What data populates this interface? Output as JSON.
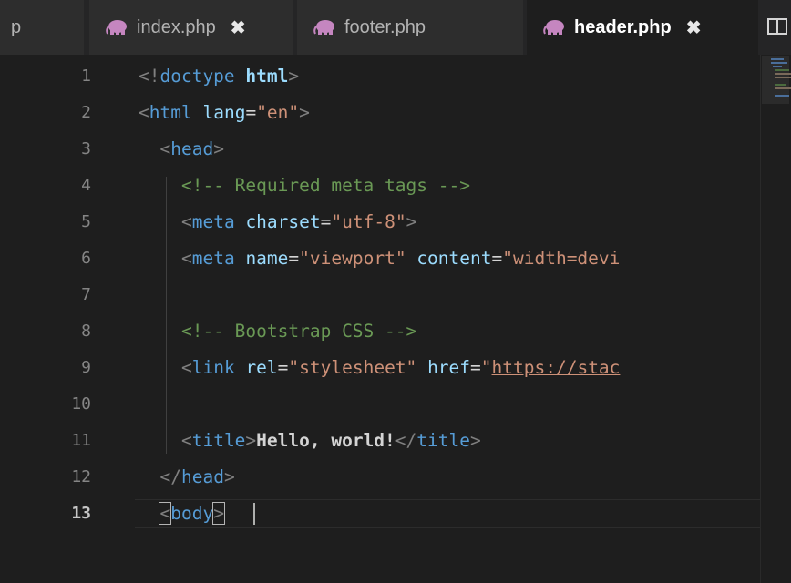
{
  "tabs": {
    "partial_label": "p",
    "items": [
      {
        "label": "index.php",
        "close": "✖"
      },
      {
        "label": "footer.php",
        "close": ""
      },
      {
        "label": "header.php",
        "close": "✖"
      }
    ]
  },
  "editor": {
    "active_file": "header.php",
    "current_line": "13",
    "line_numbers": [
      "1",
      "2",
      "3",
      "4",
      "5",
      "6",
      "7",
      "8",
      "9",
      "10",
      "11",
      "12",
      "13"
    ],
    "lines": [
      [
        [
          "punc",
          "<!"
        ],
        [
          "tag",
          "doctype"
        ],
        [
          "text",
          " "
        ],
        [
          "attrb",
          "html"
        ],
        [
          "punc",
          ">"
        ]
      ],
      [
        [
          "punc",
          "<"
        ],
        [
          "tag",
          "html"
        ],
        [
          "text",
          " "
        ],
        [
          "attr",
          "lang"
        ],
        [
          "text",
          "="
        ],
        [
          "str",
          "\"en\""
        ],
        [
          "punc",
          ">"
        ]
      ],
      [
        [
          "text",
          "  "
        ],
        [
          "punc",
          "<"
        ],
        [
          "tag",
          "head"
        ],
        [
          "punc",
          ">"
        ]
      ],
      [
        [
          "text",
          "    "
        ],
        [
          "comment",
          "<!-- Required meta tags -->"
        ]
      ],
      [
        [
          "text",
          "    "
        ],
        [
          "punc",
          "<"
        ],
        [
          "tag",
          "meta"
        ],
        [
          "text",
          " "
        ],
        [
          "attr",
          "charset"
        ],
        [
          "text",
          "="
        ],
        [
          "str",
          "\"utf-8\""
        ],
        [
          "punc",
          ">"
        ]
      ],
      [
        [
          "text",
          "    "
        ],
        [
          "punc",
          "<"
        ],
        [
          "tag",
          "meta"
        ],
        [
          "text",
          " "
        ],
        [
          "attr",
          "name"
        ],
        [
          "text",
          "="
        ],
        [
          "str",
          "\"viewport\""
        ],
        [
          "text",
          " "
        ],
        [
          "attr",
          "content"
        ],
        [
          "text",
          "="
        ],
        [
          "str",
          "\"width=devi"
        ]
      ],
      [],
      [
        [
          "text",
          "    "
        ],
        [
          "comment",
          "<!-- Bootstrap CSS -->"
        ]
      ],
      [
        [
          "text",
          "    "
        ],
        [
          "punc",
          "<"
        ],
        [
          "tag",
          "link"
        ],
        [
          "text",
          " "
        ],
        [
          "attr",
          "rel"
        ],
        [
          "text",
          "="
        ],
        [
          "str",
          "\"stylesheet\""
        ],
        [
          "text",
          " "
        ],
        [
          "attr",
          "href"
        ],
        [
          "text",
          "="
        ],
        [
          "str",
          "\""
        ],
        [
          "link",
          "https://stac"
        ]
      ],
      [],
      [
        [
          "text",
          "    "
        ],
        [
          "punc",
          "<"
        ],
        [
          "tag",
          "title"
        ],
        [
          "punc",
          ">"
        ],
        [
          "textb",
          "Hello, world!"
        ],
        [
          "punc",
          "</"
        ],
        [
          "tag",
          "title"
        ],
        [
          "punc",
          ">"
        ]
      ],
      [
        [
          "text",
          "  "
        ],
        [
          "punc",
          "</"
        ],
        [
          "tag",
          "head"
        ],
        [
          "punc",
          ">"
        ]
      ],
      [
        [
          "text",
          "  "
        ],
        [
          "matchpunc",
          "<"
        ],
        [
          "tag",
          "body"
        ],
        [
          "matchpunc",
          ">"
        ]
      ]
    ]
  },
  "colors": {
    "background": "#1e1e1e",
    "tab_bar": "#252526",
    "tag": "#569cd6",
    "attribute": "#9cdcfe",
    "string": "#ce9178",
    "comment": "#6a9955",
    "php_icon": "#c586c0"
  },
  "icons": {
    "file_icon": "php-elephant-icon",
    "split_editor": "split-editor-icon"
  }
}
